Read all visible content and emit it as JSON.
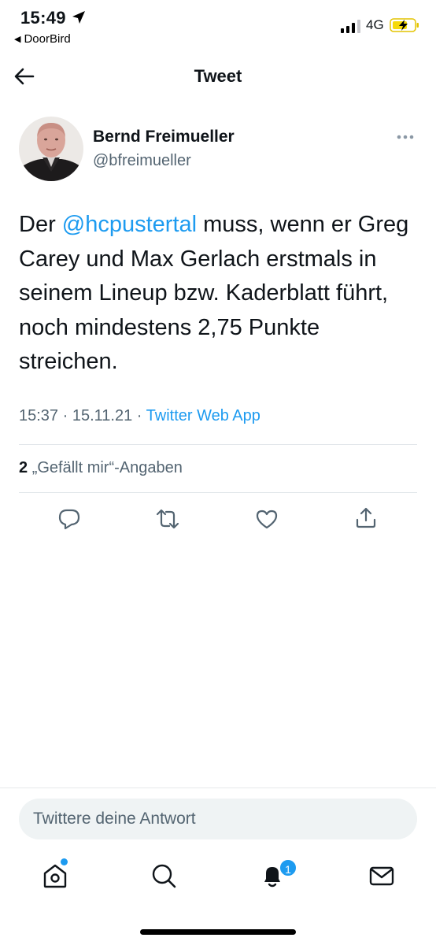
{
  "status_bar": {
    "time": "15:49",
    "back_app": "DoorBird",
    "network": "4G"
  },
  "header": {
    "title": "Tweet"
  },
  "tweet": {
    "author_name": "Bernd Freimueller",
    "author_handle": "@bfreimueller",
    "text_before": "Der ",
    "mention": "@hcpustertal",
    "text_after": " muss, wenn er Greg Carey und Max Gerlach erstmals in seinem Lineup bzw. Kaderblatt führt, noch mindestens 2,75 Punkte streichen.",
    "time": "15:37",
    "date": "15.11.21",
    "source": "Twitter Web App",
    "like_count": "2",
    "like_label": "„Gefällt mir“-Angaben"
  },
  "reply": {
    "placeholder": "Twittere deine Antwort"
  },
  "tabbar": {
    "notifications_count": "1"
  },
  "colors": {
    "accent": "#1d9bf0",
    "secondary_text": "#536471",
    "primary_text": "#0f1419"
  },
  "icons": [
    "location-arrow-icon",
    "signal-icon",
    "battery-charging-icon",
    "back-arrow-icon",
    "more-icon",
    "reply-icon",
    "retweet-icon",
    "like-icon",
    "share-icon",
    "home-icon",
    "search-icon",
    "notifications-icon",
    "messages-icon"
  ]
}
